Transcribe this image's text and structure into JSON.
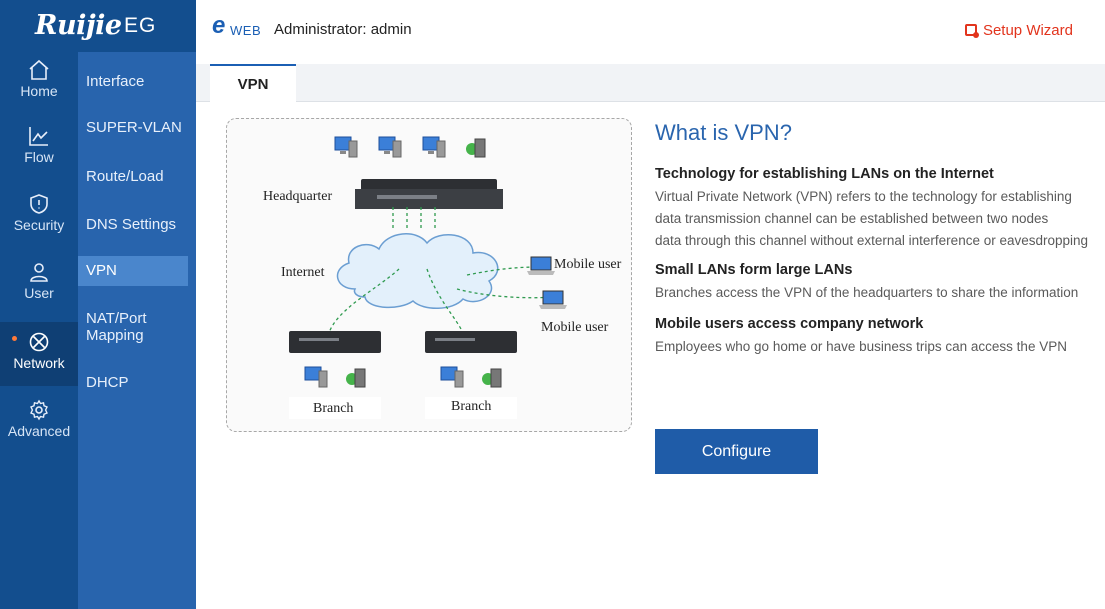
{
  "brand": {
    "logo": "Ruijie",
    "product": "EG"
  },
  "header": {
    "eweb_e": "e",
    "eweb_label": "WEB",
    "admin_text": "Administrator: admin",
    "setup_wizard": "Setup Wizard",
    "accent_color": "#e2341d"
  },
  "rail": [
    {
      "label": "Home",
      "icon": "home-icon"
    },
    {
      "label": "Flow",
      "icon": "flow-icon"
    },
    {
      "label": "Security",
      "icon": "shield-icon"
    },
    {
      "label": "User",
      "icon": "user-icon"
    },
    {
      "label": "Network",
      "icon": "network-icon",
      "active": true
    },
    {
      "label": "Advanced",
      "icon": "gear-icon"
    }
  ],
  "submenu": [
    {
      "label": "Interface"
    },
    {
      "label": "SUPER-VLAN"
    },
    {
      "label": "Route/Load"
    },
    {
      "label": "DNS Settings"
    },
    {
      "label": "VPN",
      "active": true
    },
    {
      "label_line1": "NAT/Port",
      "label_line2": "Mapping"
    },
    {
      "label": "DHCP"
    }
  ],
  "tabs": [
    {
      "label": "VPN",
      "active": true
    }
  ],
  "diagram": {
    "headquarter": "Headquarter",
    "internet": "Internet",
    "mobile_user_1": "Mobile user",
    "mobile_user_2": "Mobile user",
    "branch_1": "Branch",
    "branch_2": "Branch"
  },
  "info": {
    "title": "What is VPN?",
    "sections": [
      {
        "heading": "Technology for establishing LANs on the Internet",
        "lines": [
          "Virtual Private Network (VPN) refers to the technology for establishing",
          "data transmission channel can be established between two nodes",
          "data through this channel without external interference or eavesdropping"
        ]
      },
      {
        "heading": "Small LANs form large LANs",
        "lines": [
          "Branches access the VPN of the headquarters to share the information"
        ]
      },
      {
        "heading": "Mobile users access company network",
        "lines": [
          "Employees who go home or have business trips can access the VPN"
        ]
      }
    ]
  },
  "configure_button": "Configure",
  "colors": {
    "rail": "#134e8e",
    "submenu": "#2864ad",
    "submenu_active": "#4a86cc",
    "primary": "#1f5ca8",
    "title": "#2a65ae"
  }
}
